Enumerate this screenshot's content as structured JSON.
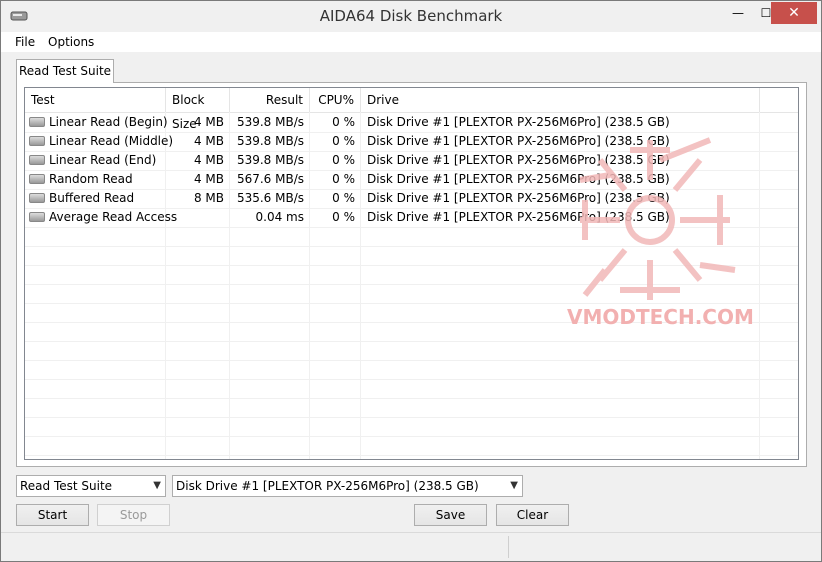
{
  "window": {
    "title": "AIDA64 Disk Benchmark",
    "close_glyph": "✕",
    "minimize_glyph": "—",
    "maximize_glyph": "☐"
  },
  "menu": [
    "File",
    "Options"
  ],
  "tab": {
    "label": "Read Test Suite"
  },
  "table": {
    "headers": [
      "Test",
      "Block Size",
      "Result",
      "CPU%",
      "Drive"
    ],
    "rows": [
      {
        "test": "Linear Read (Begin)",
        "block": "4 MB",
        "result": "539.8 MB/s",
        "cpu": "0 %",
        "drive": "Disk Drive #1  [PLEXTOR PX-256M6Pro]  (238.5 GB)"
      },
      {
        "test": "Linear Read (Middle)",
        "block": "4 MB",
        "result": "539.8 MB/s",
        "cpu": "0 %",
        "drive": "Disk Drive #1  [PLEXTOR PX-256M6Pro]  (238.5 GB)"
      },
      {
        "test": "Linear Read (End)",
        "block": "4 MB",
        "result": "539.8 MB/s",
        "cpu": "0 %",
        "drive": "Disk Drive #1  [PLEXTOR PX-256M6Pro]  (238.5 GB)"
      },
      {
        "test": "Random Read",
        "block": "4 MB",
        "result": "567.6 MB/s",
        "cpu": "0 %",
        "drive": "Disk Drive #1  [PLEXTOR PX-256M6Pro]  (238.5 GB)"
      },
      {
        "test": "Buffered Read",
        "block": "8 MB",
        "result": "535.6 MB/s",
        "cpu": "0 %",
        "drive": "Disk Drive #1  [PLEXTOR PX-256M6Pro]  (238.5 GB)"
      },
      {
        "test": "Average Read Access",
        "block": "",
        "result": "0.04 ms",
        "cpu": "0 %",
        "drive": "Disk Drive #1  [PLEXTOR PX-256M6Pro]  (238.5 GB)"
      }
    ]
  },
  "controls": {
    "suite_select": "Read Test Suite",
    "drive_select": "Disk Drive #1  [PLEXTOR PX-256M6Pro]  (238.5 GB)",
    "start": "Start",
    "stop": "Stop",
    "save": "Save",
    "clear": "Clear"
  },
  "watermark": {
    "text": "VMODTECH.COM"
  },
  "colors": {
    "close_button": "#c7504b",
    "watermark": "#f2b0b0"
  }
}
